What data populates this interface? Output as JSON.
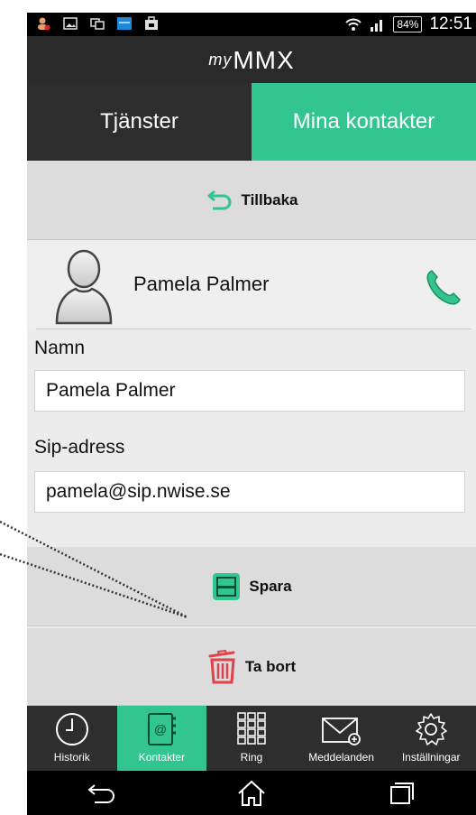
{
  "status_bar": {
    "battery": "84%",
    "time": "12:51"
  },
  "app": {
    "logo_prefix": "my",
    "logo_main": "MMX"
  },
  "tabs": [
    {
      "label": "Tjänster",
      "active": false
    },
    {
      "label": "Mina kontakter",
      "active": true
    }
  ],
  "back_button": {
    "label": "Tillbaka",
    "icon": "back-arrow-icon"
  },
  "contact": {
    "name": "Pamela Palmer",
    "avatar": "person-avatar-icon",
    "call_icon": "phone-icon"
  },
  "form": {
    "name_label": "Namn",
    "name_value": "Pamela Palmer",
    "sip_label": "Sip-adress",
    "sip_value": "pamela@sip.nwise.se"
  },
  "save_button": {
    "label": "Spara",
    "icon": "floppy-icon"
  },
  "delete_button": {
    "label": "Ta bort",
    "icon": "trash-icon"
  },
  "nav": [
    {
      "label": "Historik",
      "icon": "clock-icon",
      "active": false
    },
    {
      "label": "Kontakter",
      "icon": "contacts-book-icon",
      "active": true
    },
    {
      "label": "Ring",
      "icon": "dialpad-icon",
      "active": false
    },
    {
      "label": "Meddelanden",
      "icon": "envelope-icon",
      "active": false
    },
    {
      "label": "Inställningar",
      "icon": "gear-icon",
      "active": false
    }
  ],
  "colors": {
    "accent": "#33c58f",
    "dark": "#2d2d2d",
    "delete_red": "#e0414a"
  }
}
